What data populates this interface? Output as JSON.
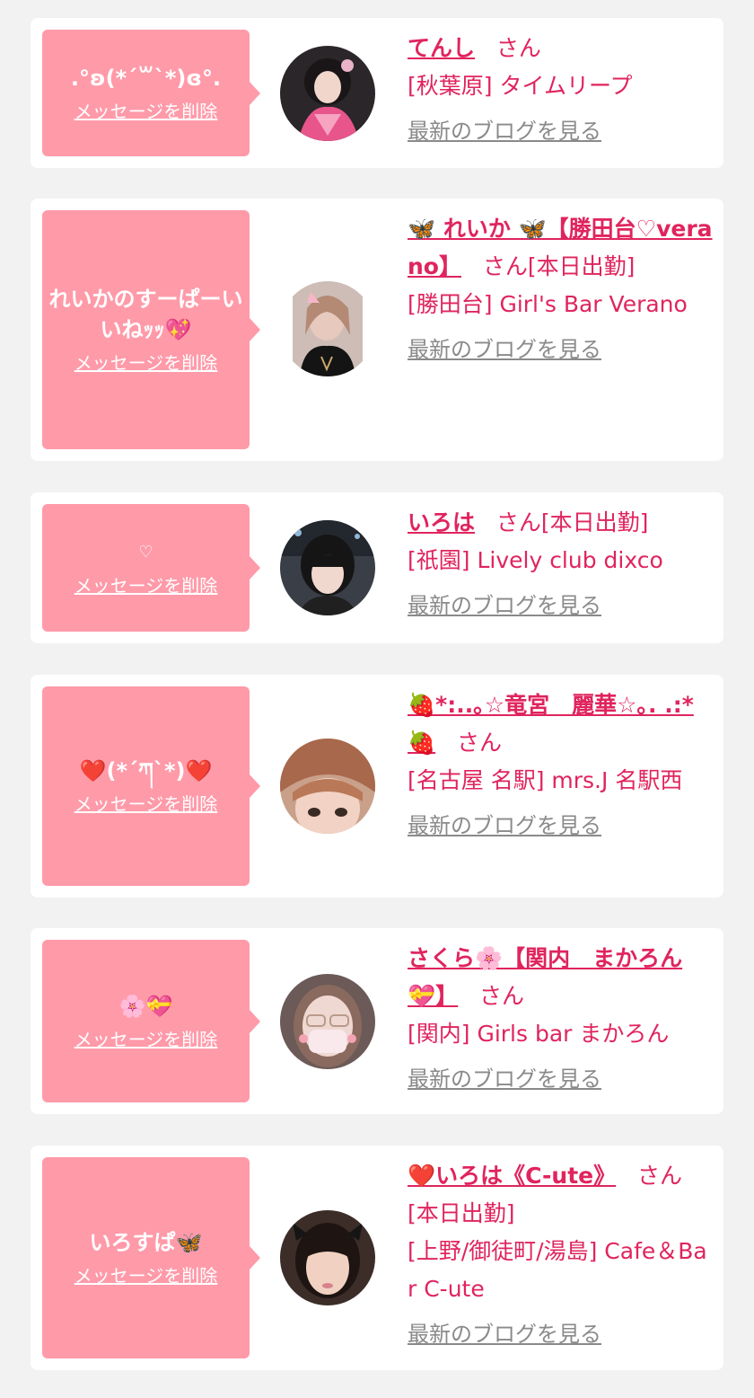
{
  "common": {
    "delete_label": "メッセージを削除",
    "blog_label": "最新のブログを見る",
    "san": "さん",
    "name_color": "#e0245e",
    "bubble_color": "#ff9aa9"
  },
  "cards": [
    {
      "message": ".°ʚ(*´꒳`*)ɞ°.",
      "name": "てんし",
      "status": "",
      "shop": "[秋葉原] タイムリープ"
    },
    {
      "message": "れいかのすーぱーいいねｯｯ💖",
      "name": "🦋 れいか 🦋【勝田台♡verano】",
      "status": "[本日出勤]",
      "shop": "[勝田台] Girl's Bar Verano"
    },
    {
      "message": "♡",
      "name": "いろは",
      "status": "[本日出勤]",
      "shop": "[祇園] Lively club dixco"
    },
    {
      "message": "❤️(*´ཀ`*)❤️",
      "name": "🍓*:..｡☆竜宮　麗華☆｡. .:*🍓",
      "status": "",
      "shop": "[名古屋 名駅] mrs.J 名駅西"
    },
    {
      "message": "🌸💝",
      "name": "さくら🌸【関内　まかろん💝】",
      "status": "",
      "shop": "[関内] Girls bar まかろん"
    },
    {
      "message": "いろすぱ🦋",
      "name": "❤️いろは《C-ute》",
      "status": "[本日出勤]",
      "shop": "[上野/御徒町/湯島] Cafe＆Bar C-ute"
    }
  ]
}
